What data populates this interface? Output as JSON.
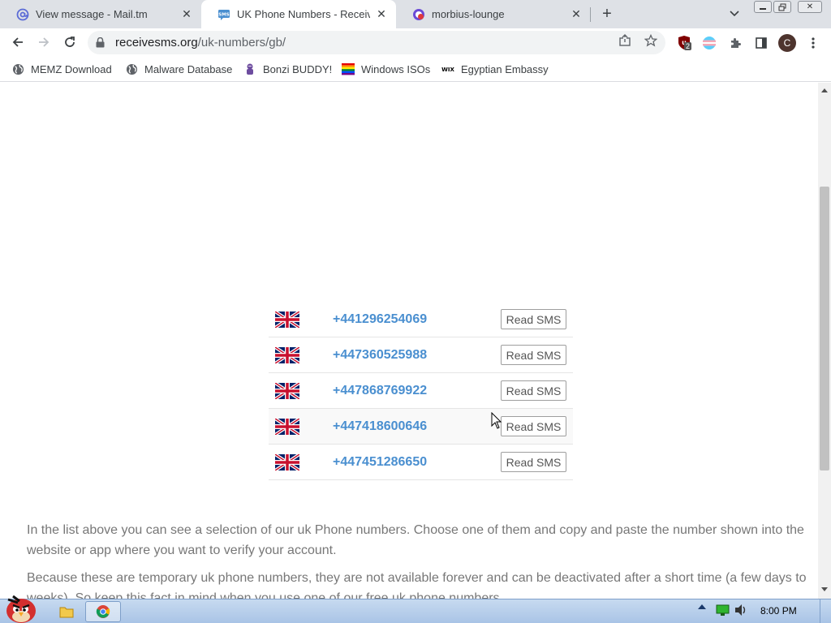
{
  "tabs": [
    {
      "title": "View message - Mail.tm",
      "favicon": "at-sign-icon"
    },
    {
      "title": "UK Phone Numbers - Receive",
      "favicon": "sms-icon",
      "active": true
    },
    {
      "title": "morbius-lounge",
      "favicon": "morbius-icon"
    }
  ],
  "address_bar": {
    "domain": "receivesms.org",
    "path": "/uk-numbers/gb/"
  },
  "profile_initial": "C",
  "extension_badge": "2",
  "bookmarks": [
    {
      "label": "MEMZ Download",
      "icon": "globe-icon"
    },
    {
      "label": "Malware Database",
      "icon": "globe-icon"
    },
    {
      "label": "Bonzi BUDDY!",
      "icon": "bonzi-icon"
    },
    {
      "label": "Windows ISOs",
      "icon": "rainbow-flag-icon"
    },
    {
      "label": "Egyptian Embassy",
      "icon": "wix-icon"
    }
  ],
  "numbers": [
    {
      "phone": "+441296254069",
      "button": "Read SMS"
    },
    {
      "phone": "+447360525988",
      "button": "Read SMS"
    },
    {
      "phone": "+447868769922",
      "button": "Read SMS"
    },
    {
      "phone": "+447418600646",
      "button": "Read SMS"
    },
    {
      "phone": "+447451286650",
      "button": "Read SMS"
    }
  ],
  "paragraphs": [
    "In the list above you can see a selection of our uk Phone numbers. Choose one of them and copy and paste the number shown into the website or app where you want to verify your account.",
    "Because these are temporary uk phone numbers, they are not available forever and can be deactivated after a short time (a few days to weeks). So keep this fact in mind when you use one of our free uk phone numbers."
  ],
  "taskbar": {
    "clock": "8:00 PM"
  },
  "colors": {
    "link": "#4a8fd0",
    "text": "#777777",
    "tabstrip": "#dee1e6"
  }
}
